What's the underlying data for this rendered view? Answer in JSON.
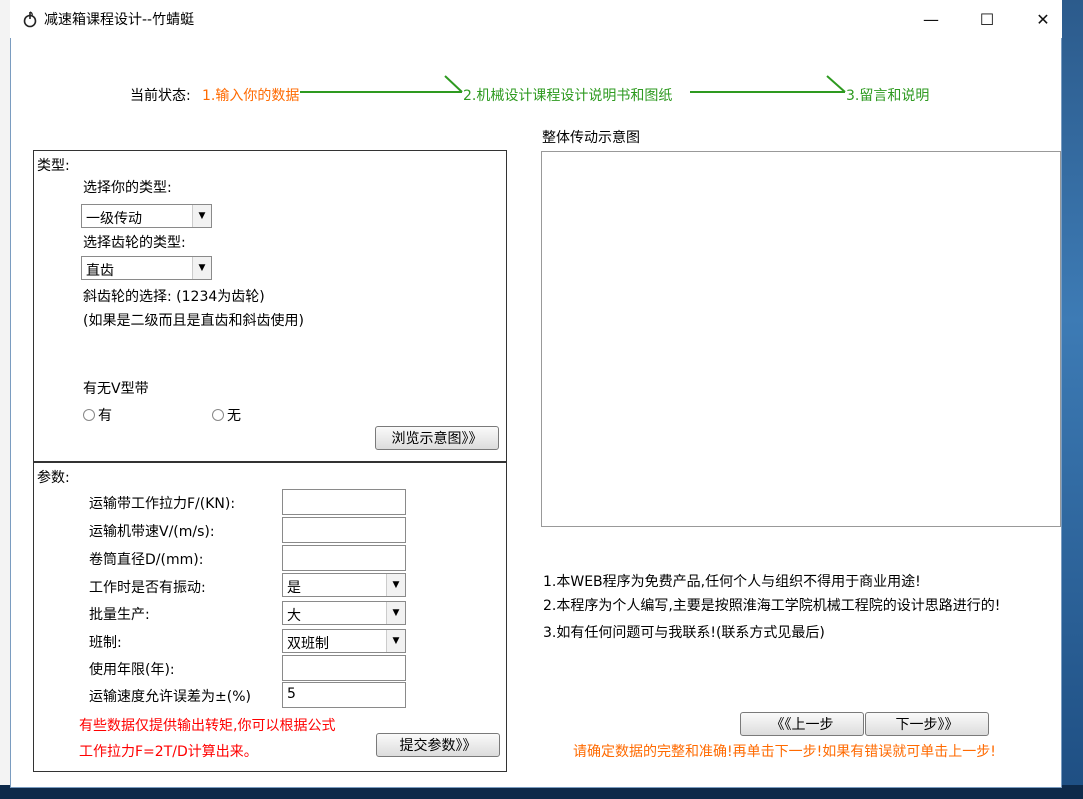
{
  "window": {
    "title": "减速箱课程设计--竹蜻蜓",
    "minimize": "—",
    "maximize": "☐",
    "close": "✕"
  },
  "status": {
    "label": "当前状态:",
    "step1": "1.输入你的数据",
    "step2": "2.机械设计课程设计说明书和图纸",
    "step3": "3.留言和说明"
  },
  "type_panel": {
    "heading": "类型:",
    "choose_type_label": "选择你的类型:",
    "choose_type_value": "一级传动",
    "gear_type_label": "选择齿轮的类型:",
    "gear_type_value": "直齿",
    "helical_label": "斜齿轮的选择: (1234为齿轮)",
    "helical_note": "(如果是二级而且是直齿和斜齿使用)",
    "vbelt_label": "有无V型带",
    "vbelt_yes": "有",
    "vbelt_no": "无",
    "browse_button": "浏览示意图》》"
  },
  "params_panel": {
    "heading": "参数:",
    "fields": [
      {
        "label": "运输带工作拉力F/(KN):",
        "value": ""
      },
      {
        "label": "运输机带速V/(m/s):",
        "value": ""
      },
      {
        "label": "卷筒直径D/(mm):",
        "value": ""
      }
    ],
    "vibration_label": "工作时是否有振动:",
    "vibration_value": "是",
    "batch_label": "批量生产:",
    "batch_value": "大",
    "shift_label": "班制:",
    "shift_value": "双班制",
    "years_label": "使用年限(年):",
    "years_value": "",
    "tolerance_label": "运输速度允许误差为±(%)",
    "tolerance_value": "5",
    "note_line1": "有些数据仅提供输出转矩,你可以根据公式",
    "note_line2": "工作拉力F=2T/D计算出来。",
    "submit_button": "提交参数》》"
  },
  "diagram": {
    "title": "整体传动示意图"
  },
  "notes": [
    "1.本WEB程序为免费产品,任何个人与组织不得用于商业用途!",
    "2.本程序为个人编写,主要是按照淮海工学院机械工程院的设计思路进行的!",
    "3.如有任何问题可与我联系!(联系方式见最后)"
  ],
  "nav": {
    "prev_button": "《《上一步",
    "next_button": "下一步》》",
    "hint": "请确定数据的完整和准确!再单击下一步!如果有错误就可单击上一步!"
  },
  "colors": {
    "orange": "#ff6a00",
    "green": "#2e9a20",
    "red": "#ff0000"
  }
}
